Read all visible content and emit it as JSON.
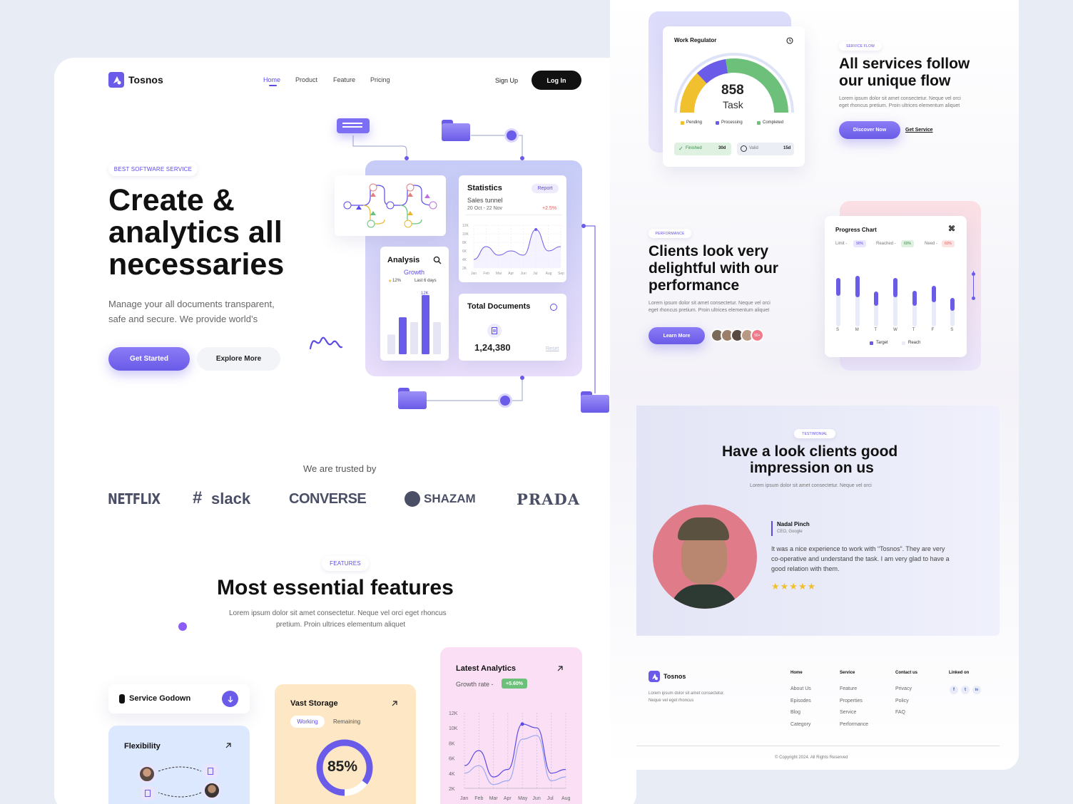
{
  "left": {
    "brand": "Tosnos",
    "nav": [
      "Home",
      "Product",
      "Feature",
      "Pricing"
    ],
    "signup": "Sign Up",
    "login": "Log In",
    "hero_tag": "BEST SOFTWARE SERVICE",
    "hero_title_1": "Create &",
    "hero_title_2": "analytics all",
    "hero_title_3": "necessaries",
    "hero_desc_1": "Manage your all documents transparent,",
    "hero_desc_2": "safe and secure. We provide world’s",
    "btn_started": "Get Started",
    "btn_explore": "Explore More",
    "stats_title": "Statistics",
    "stats_report": "Report",
    "stats_sub": "Sales tunnel",
    "stats_date": "20 Oct - 22 Nov",
    "stats_change": "+2.5%",
    "stats_y": [
      "12K",
      "10K",
      "8K",
      "6K",
      "4K",
      "2K"
    ],
    "stats_x": [
      "Jan",
      "Feb",
      "Mar",
      "Apr",
      "Jun",
      "Jul",
      "Aug",
      "Sep"
    ],
    "analysis_title": "Analysis",
    "analysis_growth": "Growth",
    "analysis_pct": "12%",
    "analysis_period": "Last 6 days",
    "analysis_peak": "12K",
    "docs_title": "Total Documents",
    "docs_value": "1,24,380",
    "docs_reset": "Reset",
    "trusted": "We are trusted by",
    "brands": [
      "NETFLIX",
      "slack",
      "CONVERSE",
      "SHAZAM",
      "PRADA"
    ],
    "features_tag": "FEATURES",
    "features_title": "Most essential features",
    "features_desc_1": "Lorem ipsum dolor sit amet consectetur. Neque vel orci eget rhoncus",
    "features_desc_2": "pretium. Proin ultrices elementum aliquet",
    "service_godown": "Service Godown",
    "flexibility": "Flexibility",
    "vast_storage": "Vast Storage",
    "storage_working": "Working",
    "storage_remaining": "Remaining",
    "storage_pct": "85%",
    "latest_title": "Latest Analytics",
    "growth_rate": "Growth rate -",
    "growth_value": "+5.60%",
    "latest_y": [
      "12K",
      "10K",
      "8K",
      "6K",
      "4K",
      "2K"
    ],
    "latest_x": [
      "Jan",
      "Feb",
      "Mar",
      "Apr",
      "May",
      "Jun",
      "Jul",
      "Aug"
    ]
  },
  "right": {
    "work_title": "Work Regulator",
    "gauge_value": "858",
    "gauge_label": "Task",
    "legend": [
      "Pending",
      "Processing",
      "Completed"
    ],
    "finished_label": "Finished",
    "finished_value": "30d",
    "valid_label": "Valid",
    "valid_value": "15d",
    "service_tag": "SERVICE FLOW",
    "service_title_1": "All services follow",
    "service_title_2": "our unique flow",
    "service_desc_1": "Lorem ipsum dolor sit amet consectetur. Neque vel orci",
    "service_desc_2": "eget rhoncus pretium. Proin ultrices elementum aliquet",
    "discover": "Discover Now",
    "get_service": "Get Service",
    "perf_tag": "PERFORMANCE",
    "perf_title_1": "Clients look very",
    "perf_title_2": "delightful with our",
    "perf_title_3": "performance",
    "perf_desc_1": "Lorem ipsum dolor sit amet consectetur. Neque vel orci",
    "perf_desc_2": "eget rhoncus pretium. Proin ultrices elementum aliquet",
    "learn_more": "Learn More",
    "avatar_more": "50+",
    "progress_title": "Progress Chart",
    "limit_label": "Limit -",
    "limit_value": "90%",
    "reached_label": "Reached -",
    "reached_value": "60%",
    "need_label": "Need -",
    "need_value": "60%",
    "days": [
      "S",
      "M",
      "T",
      "W",
      "T",
      "F",
      "S"
    ],
    "target": "Target",
    "reach": "Reach",
    "testi_tag": "TESTIMONIAL",
    "testi_title_1": "Have a look clients good",
    "testi_title_2": "impression on us",
    "testi_sub": "Lorem ipsum dolor sit amet consectetur. Neque vel orci",
    "testi_name": "Nadal Pinch",
    "testi_role": "CEO, Google",
    "testi_quote_1": "It was a nice experience to work with “Tosnos”. They are very",
    "testi_quote_2": "co-operative and understand the task. I am very glad to have a",
    "testi_quote_3": "good relation with them.",
    "stars": "★★★★★",
    "footer_brand": "Tosnos",
    "footer_desc_1": "Lorem ipsum dolor sit amet consectetur.",
    "footer_desc_2": "Neque vel eget rhoncus",
    "col_home": "Home",
    "col_home_items": [
      "About Us",
      "Episodes",
      "Blog",
      "Category"
    ],
    "col_service": "Service",
    "col_service_items": [
      "Feature",
      "Properties",
      "Service",
      "Performance"
    ],
    "col_contact": "Contact us",
    "col_contact_items": [
      "Privacy",
      "Policy",
      "FAQ"
    ],
    "col_linked": "Linked on",
    "social": [
      "f",
      "t",
      "in"
    ],
    "copyright": "© Copyright 2024. All Rights Reserved"
  },
  "chart_data": [
    {
      "type": "line",
      "title": "Statistics",
      "x": [
        "Jan",
        "Feb",
        "Mar",
        "Apr",
        "Jun",
        "Jul",
        "Aug",
        "Sep"
      ],
      "series": [
        {
          "values": [
            4,
            7,
            5,
            6,
            5,
            11,
            6,
            7
          ]
        }
      ],
      "ylim": [
        2,
        12
      ]
    },
    {
      "type": "bar",
      "title": "Analysis",
      "values": [
        4,
        7.5,
        6.5,
        12,
        6.5
      ],
      "ylim": [
        0,
        12
      ]
    },
    {
      "type": "line",
      "title": "Latest Analytics",
      "x": [
        "Jan",
        "Feb",
        "Mar",
        "Apr",
        "May",
        "Jun",
        "Jul",
        "Aug"
      ],
      "series": [
        {
          "values": [
            5,
            7,
            3.5,
            4.5,
            10.5,
            10,
            4,
            4.5
          ]
        },
        {
          "values": [
            4,
            5,
            2.5,
            3,
            8.5,
            9,
            3,
            3.5
          ]
        }
      ],
      "ylim": [
        2,
        12
      ]
    },
    {
      "type": "bar",
      "title": "Progress Chart",
      "categories": [
        "S",
        "M",
        "T",
        "W",
        "T",
        "F",
        "S"
      ],
      "series": [
        {
          "name": "Target",
          "values": [
            55,
            70,
            35,
            62,
            38,
            48,
            28
          ]
        },
        {
          "name": "Reach",
          "values": [
            95,
            100,
            60,
            95,
            62,
            75,
            45
          ]
        }
      ]
    }
  ]
}
